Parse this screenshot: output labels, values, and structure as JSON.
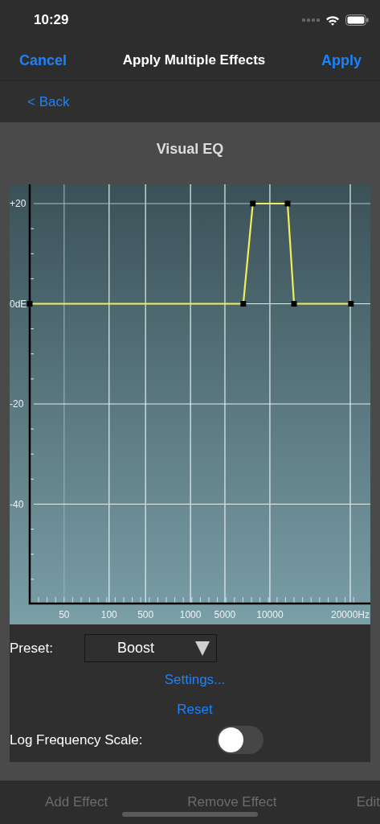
{
  "status_bar": {
    "time": "10:29"
  },
  "nav_bar": {
    "left": "Cancel",
    "title": "Apply Multiple Effects",
    "right": "Apply"
  },
  "back": {
    "label": "< Back"
  },
  "panel": {
    "title": "Visual EQ",
    "eq_graph": {
      "y_labels": [
        "+20",
        "0dE",
        "-20",
        "-40"
      ],
      "x_labels": [
        "50",
        "100",
        "500",
        "1000",
        "5000",
        "10000",
        "20000Hz"
      ]
    },
    "preset": {
      "label": "Preset:",
      "value": "Boost"
    },
    "links": [
      "Settings...",
      "Reset"
    ],
    "log_scale": {
      "label": "Log Frequency Scale:",
      "on": false
    }
  },
  "toolbar": [
    {
      "label": "Add Effect",
      "disabled": true
    },
    {
      "label": "Remove Effect",
      "disabled": true
    },
    {
      "label": "Edit",
      "disabled": true
    }
  ]
}
